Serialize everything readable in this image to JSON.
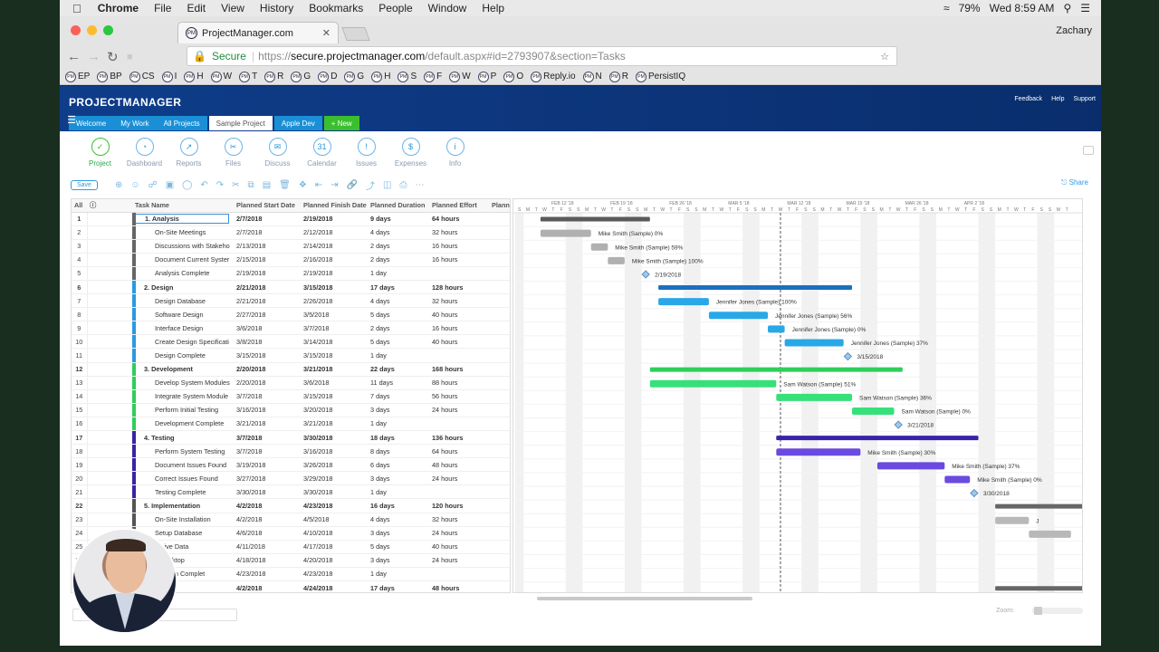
{
  "os_menubar": {
    "app": "Chrome",
    "items": [
      "File",
      "Edit",
      "View",
      "History",
      "Bookmarks",
      "People",
      "Window",
      "Help"
    ],
    "battery": "79%",
    "clock": "Wed 8:59 AM"
  },
  "browser": {
    "tab_title": "ProjectManager.com",
    "profile": "Zachary",
    "secure_label": "Secure",
    "url_scheme": "https://",
    "url_host": "secure.projectmanager.com",
    "url_path": "/default.aspx#id=2793907&section=Tasks",
    "bookmarks": [
      "EP",
      "BP",
      "CS",
      "I",
      "H",
      "W",
      "T",
      "R",
      "G",
      "D",
      "G",
      "H",
      "S",
      "F",
      "W",
      "P",
      "O",
      "Reply.io",
      "N",
      "R",
      "PersistIQ"
    ]
  },
  "app": {
    "logo": "PROJECTMANAGER",
    "top_links": [
      "Feedback",
      "Help",
      "Support"
    ],
    "nav_tabs": [
      {
        "label": "Welcome",
        "active": false
      },
      {
        "label": "My Work",
        "active": false
      },
      {
        "label": "All Projects",
        "active": false
      },
      {
        "label": "Sample Project",
        "active": true
      },
      {
        "label": "Apple Dev",
        "active": false
      },
      {
        "label": "+ New",
        "active": false
      }
    ],
    "views": [
      {
        "label": "Project",
        "icon": "check-icon"
      },
      {
        "label": "Dashboard",
        "icon": "gauge-icon"
      },
      {
        "label": "Reports",
        "icon": "chart-line-icon"
      },
      {
        "label": "Files",
        "icon": "paperclip-icon"
      },
      {
        "label": "Discuss",
        "icon": "chat-icon"
      },
      {
        "label": "Calendar",
        "icon": "calendar-icon"
      },
      {
        "label": "Issues",
        "icon": "warning-icon"
      },
      {
        "label": "Expenses",
        "icon": "dollar-icon"
      },
      {
        "label": "Info",
        "icon": "info-icon"
      }
    ],
    "toolbar": {
      "save_label": "Save",
      "share_label": "Share"
    },
    "zoom_label": "Zoom:",
    "find_placeholder": "sk"
  },
  "table": {
    "columns": [
      "All",
      "Task Name",
      "Planned Start Date",
      "Planned Finish Date",
      "Planned Duration",
      "Planned Effort",
      "Plann"
    ],
    "rows": [
      {
        "n": "1",
        "name": "1. Analysis",
        "start": "2/7/2018",
        "finish": "2/19/2018",
        "dur": "9 days",
        "effort": "64 hours",
        "summary": true,
        "color": "#666"
      },
      {
        "n": "2",
        "name": "On-Site Meetings",
        "start": "2/7/2018",
        "finish": "2/12/2018",
        "dur": "4 days",
        "effort": "32 hours"
      },
      {
        "n": "3",
        "name": "Discussions with Stakeho",
        "start": "2/13/2018",
        "finish": "2/14/2018",
        "dur": "2 days",
        "effort": "16 hours"
      },
      {
        "n": "4",
        "name": "Document Current Syster",
        "start": "2/15/2018",
        "finish": "2/16/2018",
        "dur": "2 days",
        "effort": "16 hours"
      },
      {
        "n": "5",
        "name": "Analysis Complete",
        "start": "2/19/2018",
        "finish": "2/19/2018",
        "dur": "1 day",
        "effort": ""
      },
      {
        "n": "6",
        "name": "2. Design",
        "start": "2/21/2018",
        "finish": "3/15/2018",
        "dur": "17 days",
        "effort": "128 hours",
        "summary": true,
        "color": "#2a9ae0"
      },
      {
        "n": "7",
        "name": "Design Database",
        "start": "2/21/2018",
        "finish": "2/26/2018",
        "dur": "4 days",
        "effort": "32 hours"
      },
      {
        "n": "8",
        "name": "Software Design",
        "start": "2/27/2018",
        "finish": "3/5/2018",
        "dur": "5 days",
        "effort": "40 hours"
      },
      {
        "n": "9",
        "name": "Interface Design",
        "start": "3/6/2018",
        "finish": "3/7/2018",
        "dur": "2 days",
        "effort": "16 hours"
      },
      {
        "n": "10",
        "name": "Create Design Specificati",
        "start": "3/8/2018",
        "finish": "3/14/2018",
        "dur": "5 days",
        "effort": "40 hours"
      },
      {
        "n": "11",
        "name": "Design Complete",
        "start": "3/15/2018",
        "finish": "3/15/2018",
        "dur": "1 day",
        "effort": ""
      },
      {
        "n": "12",
        "name": "3. Development",
        "start": "2/20/2018",
        "finish": "3/21/2018",
        "dur": "22 days",
        "effort": "168 hours",
        "summary": true,
        "color": "#2fce5a"
      },
      {
        "n": "13",
        "name": "Develop System Modules",
        "start": "2/20/2018",
        "finish": "3/6/2018",
        "dur": "11 days",
        "effort": "88 hours"
      },
      {
        "n": "14",
        "name": "Integrate System Module",
        "start": "3/7/2018",
        "finish": "3/15/2018",
        "dur": "7 days",
        "effort": "56 hours"
      },
      {
        "n": "15",
        "name": "Perform Initial Testing",
        "start": "3/16/2018",
        "finish": "3/20/2018",
        "dur": "3 days",
        "effort": "24 hours"
      },
      {
        "n": "16",
        "name": "Development Complete",
        "start": "3/21/2018",
        "finish": "3/21/2018",
        "dur": "1 day",
        "effort": ""
      },
      {
        "n": "17",
        "name": "4. Testing",
        "start": "3/7/2018",
        "finish": "3/30/2018",
        "dur": "18 days",
        "effort": "136 hours",
        "summary": true,
        "color": "#3a22a8"
      },
      {
        "n": "18",
        "name": "Perform System Testing",
        "start": "3/7/2018",
        "finish": "3/16/2018",
        "dur": "8 days",
        "effort": "64 hours"
      },
      {
        "n": "19",
        "name": "Document Issues Found",
        "start": "3/19/2018",
        "finish": "3/26/2018",
        "dur": "6 days",
        "effort": "48 hours"
      },
      {
        "n": "20",
        "name": "Correct Issues Found",
        "start": "3/27/2018",
        "finish": "3/29/2018",
        "dur": "3 days",
        "effort": "24 hours"
      },
      {
        "n": "21",
        "name": "Testing Complete",
        "start": "3/30/2018",
        "finish": "3/30/2018",
        "dur": "1 day",
        "effort": ""
      },
      {
        "n": "22",
        "name": "5. Implementation",
        "start": "4/2/2018",
        "finish": "4/23/2018",
        "dur": "16 days",
        "effort": "120 hours",
        "summary": true,
        "color": "#555"
      },
      {
        "n": "23",
        "name": "On-Site Installation",
        "start": "4/2/2018",
        "finish": "4/5/2018",
        "dur": "4 days",
        "effort": "32 hours"
      },
      {
        "n": "24",
        "name": "Setup Database",
        "start": "4/6/2018",
        "finish": "4/10/2018",
        "dur": "3 days",
        "effort": "24 hours"
      },
      {
        "n": "25",
        "name": "rt Live Data",
        "start": "4/11/2018",
        "finish": "4/17/2018",
        "dur": "5 days",
        "effort": "40 hours"
      },
      {
        "n": "26",
        "name": "e Desktop",
        "start": "4/18/2018",
        "finish": "4/20/2018",
        "dur": "3 days",
        "effort": "24 hours"
      },
      {
        "n": "27",
        "name": "entation Complet",
        "start": "4/23/2018",
        "finish": "4/23/2018",
        "dur": "1 day",
        "effort": ""
      },
      {
        "n": "28",
        "name": "",
        "start": "4/2/2018",
        "finish": "4/24/2018",
        "dur": "17 days",
        "effort": "48 hours",
        "summary": true,
        "color": "#555"
      }
    ]
  },
  "gantt": {
    "week_labels": [
      "FEB 12 '18",
      "FEB 19 '18",
      "FEB 26 '18",
      "MAR 5 '18",
      "MAR 12 '18",
      "MAR 15 '18",
      "MAR 26 '18",
      "APR 2 '18"
    ],
    "day_letters": [
      "S",
      "M",
      "T",
      "W",
      "T",
      "F",
      "S"
    ],
    "bars": [
      {
        "row": 0,
        "start": "2/7/2018",
        "end": "2/19/2018",
        "type": "summary",
        "color": "#5a5a5a"
      },
      {
        "row": 1,
        "start": "2/7/2018",
        "end": "2/12/2018",
        "color": "#b0b0b0",
        "label": "Mike Smith (Sample)  0%"
      },
      {
        "row": 2,
        "start": "2/13/2018",
        "end": "2/14/2018",
        "color": "#b0b0b0",
        "label": "Mike Smith (Sample)  59%"
      },
      {
        "row": 3,
        "start": "2/15/2018",
        "end": "2/16/2018",
        "color": "#b0b0b0",
        "label": "Mike Smith (Sample)  100%"
      },
      {
        "row": 4,
        "milestone": true,
        "start": "2/19/2018",
        "label": "2/19/2018"
      },
      {
        "row": 5,
        "start": "2/21/2018",
        "end": "3/15/2018",
        "type": "summary",
        "color": "#1b6fc0"
      },
      {
        "row": 6,
        "start": "2/21/2018",
        "end": "2/26/2018",
        "color": "#29a8e8",
        "label": "Jennifer Jones (Sample)  100%"
      },
      {
        "row": 7,
        "start": "2/27/2018",
        "end": "3/5/2018",
        "color": "#29a8e8",
        "label": "Jennifer Jones (Sample)  56%"
      },
      {
        "row": 8,
        "start": "3/6/2018",
        "end": "3/7/2018",
        "color": "#29a8e8",
        "label": "Jennifer Jones (Sample)  0%"
      },
      {
        "row": 9,
        "start": "3/8/2018",
        "end": "3/14/2018",
        "color": "#29a8e8",
        "label": "Jennifer Jones (Sample)  37%"
      },
      {
        "row": 10,
        "milestone": true,
        "start": "3/15/2018",
        "label": "3/15/2018"
      },
      {
        "row": 11,
        "start": "2/20/2018",
        "end": "3/21/2018",
        "type": "summary",
        "color": "#2fce5a"
      },
      {
        "row": 12,
        "start": "2/20/2018",
        "end": "3/6/2018",
        "color": "#36e07a",
        "label": "Sam Watson (Sample)  51%"
      },
      {
        "row": 13,
        "start": "3/7/2018",
        "end": "3/15/2018",
        "color": "#36e07a",
        "label": "Sam Watson (Sample)  36%"
      },
      {
        "row": 14,
        "start": "3/16/2018",
        "end": "3/20/2018",
        "color": "#36e07a",
        "label": "Sam Watson (Sample)  0%"
      },
      {
        "row": 15,
        "milestone": true,
        "start": "3/21/2018",
        "label": "3/21/2018"
      },
      {
        "row": 16,
        "start": "3/7/2018",
        "end": "3/30/2018",
        "type": "summary",
        "color": "#3a22a8"
      },
      {
        "row": 17,
        "start": "3/7/2018",
        "end": "3/16/2018",
        "color": "#6a4ae0",
        "label": "Mike Smith (Sample)  30%"
      },
      {
        "row": 18,
        "start": "3/19/2018",
        "end": "3/26/2018",
        "color": "#6a4ae0",
        "label": "Mike Smith (Sample)  37%"
      },
      {
        "row": 19,
        "start": "3/27/2018",
        "end": "3/29/2018",
        "color": "#6a4ae0",
        "label": "Mike Smith (Sample)  0%"
      },
      {
        "row": 20,
        "milestone": true,
        "start": "3/30/2018",
        "label": "3/30/2018"
      },
      {
        "row": 21,
        "start": "4/2/2018",
        "end": "4/23/2018",
        "type": "summary",
        "color": "#666"
      },
      {
        "row": 22,
        "start": "4/2/2018",
        "end": "4/5/2018",
        "color": "#b8b8b8",
        "label": "J"
      },
      {
        "row": 23,
        "start": "4/6/2018",
        "end": "4/10/2018",
        "color": "#b8b8b8"
      },
      {
        "row": 27,
        "start": "4/2/2018",
        "end": "4/24/2018",
        "type": "summary",
        "color": "#666"
      }
    ],
    "today": "3/7/2018"
  }
}
